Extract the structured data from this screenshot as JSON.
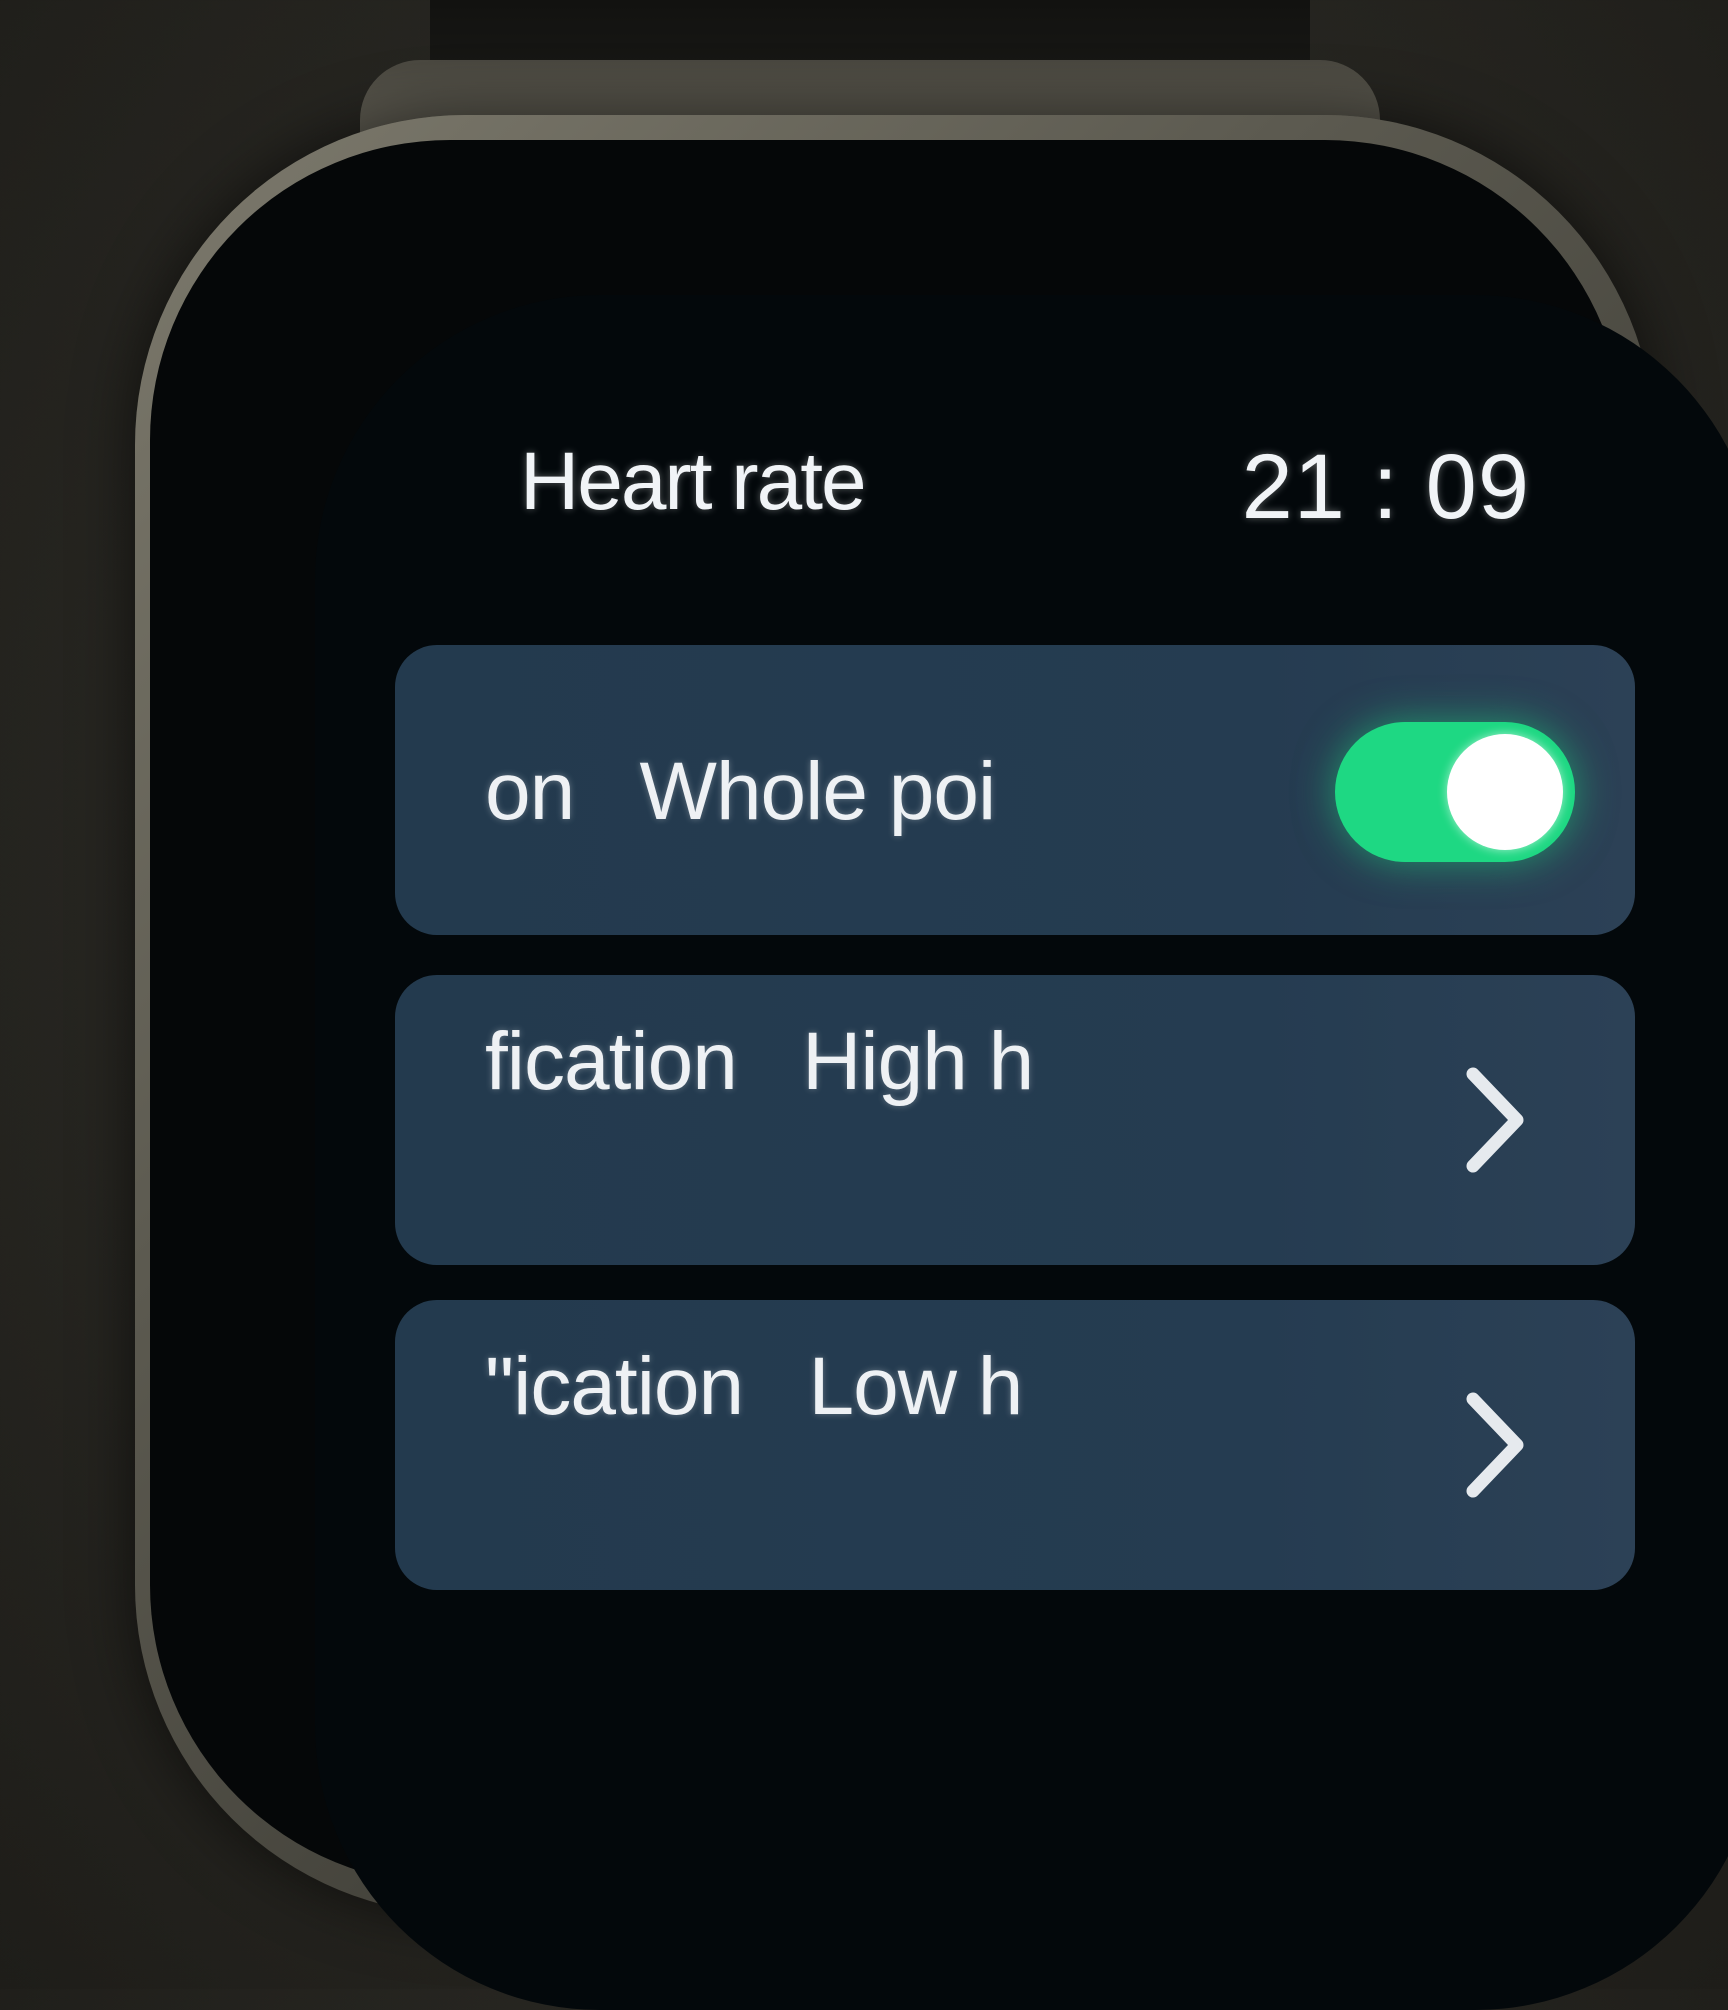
{
  "header": {
    "title": "Heart rate",
    "time": "21 : 09"
  },
  "rows": [
    {
      "label": "on   Whole poi",
      "control": "toggle",
      "toggle_on": true,
      "toggle_color": "#1ed883"
    },
    {
      "label": "fication   High h",
      "control": "chevron",
      "icon": "chevron-right-icon"
    },
    {
      "label": "\"ication   Low h",
      "control": "chevron",
      "icon": "chevron-right-icon"
    }
  ],
  "colors": {
    "screen_bg": "#03080b",
    "row_bg": "#253c51",
    "text": "#eef1f4",
    "accent_green": "#1ed883"
  }
}
